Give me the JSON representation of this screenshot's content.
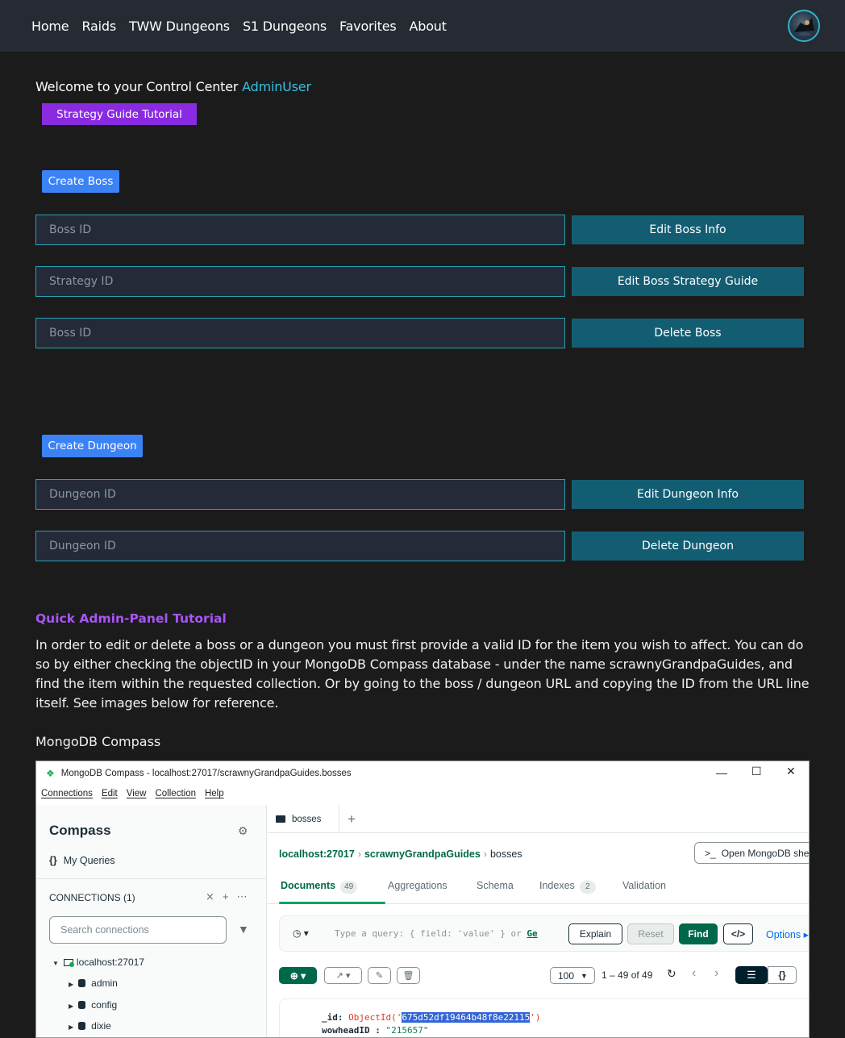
{
  "nav": {
    "items": [
      "Home",
      "Raids",
      "TWW Dungeons",
      "S1 Dungeons",
      "Favorites",
      "About"
    ]
  },
  "welcome": {
    "prefix": "Welcome to your Control Center",
    "user": "AdminUser"
  },
  "buttons": {
    "tutorial": "Strategy Guide Tutorial",
    "create_boss": "Create Boss",
    "create_dungeon": "Create Dungeon"
  },
  "boss_forms": [
    {
      "placeholder": "Boss ID",
      "action": "Edit Boss Info"
    },
    {
      "placeholder": "Strategy ID",
      "action": "Edit Boss Strategy Guide"
    },
    {
      "placeholder": "Boss ID",
      "action": "Delete Boss"
    }
  ],
  "dungeon_forms": [
    {
      "placeholder": "Dungeon ID",
      "action": "Edit Dungeon Info"
    },
    {
      "placeholder": "Dungeon ID",
      "action": "Delete Dungeon"
    }
  ],
  "tutorial": {
    "title": "Quick Admin-Panel Tutorial",
    "body": "In order to edit or delete a boss or a dungeon you must first provide a valid ID for the item you wish to affect. You can do so by either checking the objectID in your MongoDB Compass database - under the name scrawnyGrandpaGuides, and find the item within the requested collection. Or by going to the boss / dungeon URL and copying the ID from the URL line itself. See images below for reference.",
    "image_label": "MongoDB Compass"
  },
  "compass": {
    "window_title": "MongoDB Compass - localhost:27017/scrawnyGrandpaGuides.bosses",
    "menu": [
      "Connections",
      "Edit",
      "View",
      "Collection",
      "Help"
    ],
    "app_name": "Compass",
    "my_queries": "My Queries",
    "connections_label": "CONNECTIONS",
    "connections_count": "(1)",
    "search_placeholder": "Search connections",
    "host": "localhost:27017",
    "databases": [
      "admin",
      "config",
      "dixie"
    ],
    "tab": "bosses",
    "breadcrumb": [
      "localhost:27017",
      "scrawnyGrandpaGuides",
      "bosses"
    ],
    "open_shell": "Open MongoDB shell",
    "subtabs": [
      {
        "label": "Documents",
        "count": "49"
      },
      {
        "label": "Aggregations"
      },
      {
        "label": "Schema"
      },
      {
        "label": "Indexes",
        "count": "2"
      },
      {
        "label": "Validation"
      }
    ],
    "query_placeholder": "Type a query: { field: 'value' } or",
    "query_link": "Ge",
    "explain": "Explain",
    "reset": "Reset",
    "find": "Find",
    "options": "Options",
    "page_size": "100",
    "range": "1 – 49 of 49",
    "doc": {
      "id_key": "_id:",
      "id_func_open": "ObjectId('",
      "id_value": "675d52df19464b48f8e22115",
      "id_func_close": "')",
      "wowhead_key": "wowheadID :",
      "wowhead_value": "\"215657\""
    }
  }
}
